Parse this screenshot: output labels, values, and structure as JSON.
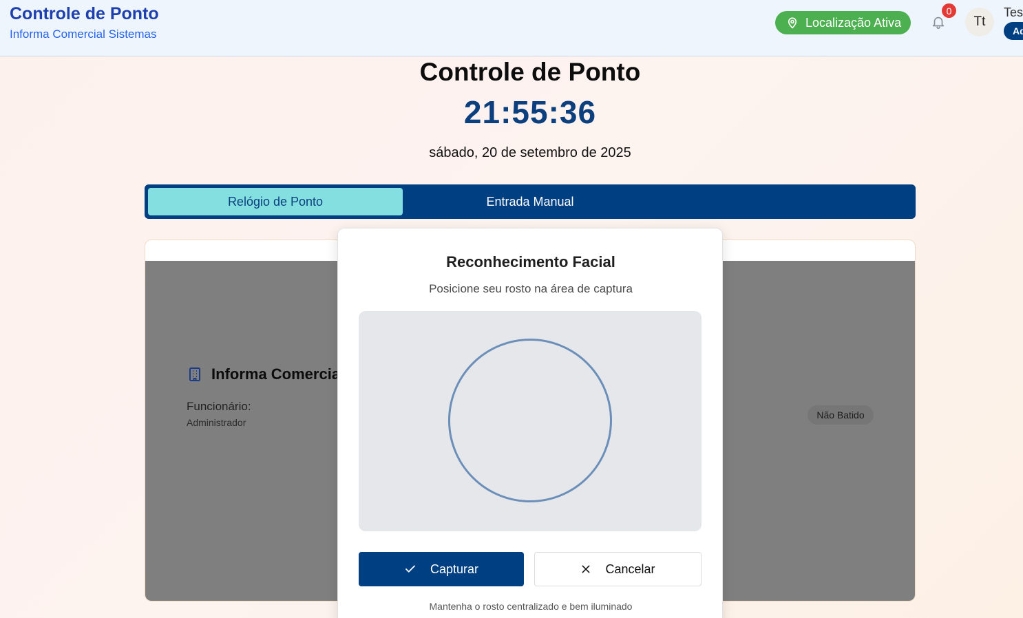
{
  "header": {
    "title": "Controle de Ponto",
    "subtitle": "Informa Comercial Sistemas",
    "location_badge": "Localização Ativa",
    "notification_count": "0",
    "avatar_initials": "Tt",
    "user_name": "Tes",
    "role": "Ad"
  },
  "main": {
    "title": "Controle de Ponto",
    "time": "21:55:36",
    "date": "sábado, 20 de setembro de 2025"
  },
  "tabs": [
    {
      "label": "Relógio de Ponto",
      "active": true
    },
    {
      "label": "Entrada Manual",
      "active": false
    }
  ],
  "card": {
    "company": "Informa Comercial",
    "employee_label": "Funcionário:",
    "employee_value": "Administrador",
    "status": "Não Batido"
  },
  "modal": {
    "title": "Reconhecimento Facial",
    "subtitle": "Posicione seu rosto na área de captura",
    "capture_label": "Capturar",
    "cancel_label": "Cancelar",
    "hint": "Mantenha o rosto centralizado e bem iluminado"
  },
  "colors": {
    "primary": "#003f82",
    "active_tab": "#84e0e0",
    "location_green": "#4caf50",
    "badge_red": "#e53935"
  },
  "icons": [
    "map-pin-icon",
    "bell-icon",
    "building-icon",
    "check-icon",
    "close-icon"
  ]
}
